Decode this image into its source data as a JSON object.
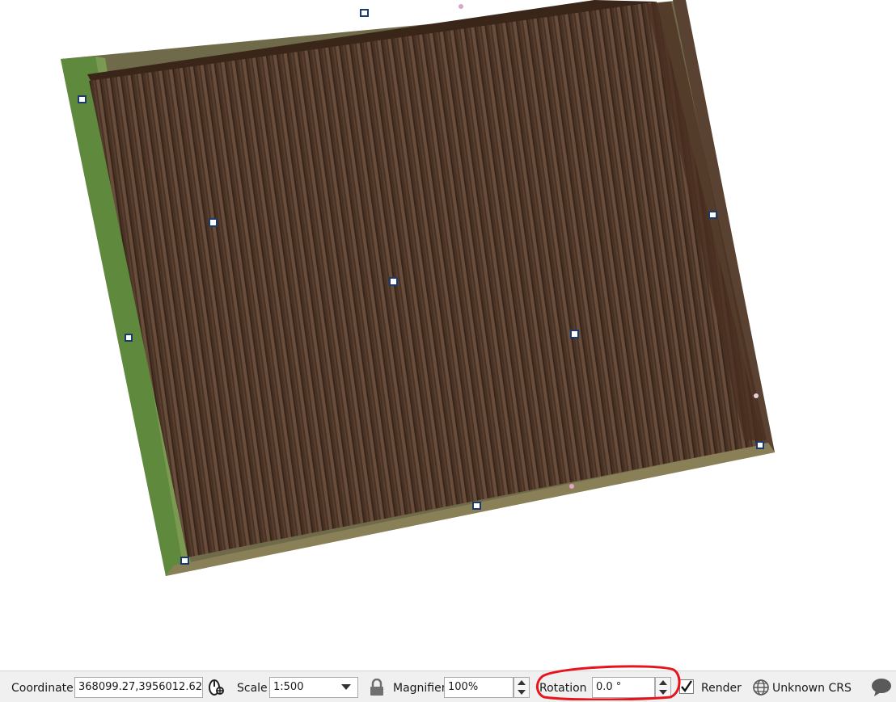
{
  "status_bar": {
    "coordinate_label": "Coordinate",
    "coordinate_value": "368099.27,3956012.62",
    "scale_label": "Scale",
    "scale_value": "1:500",
    "magnifier_label": "Magnifier",
    "magnifier_value": "100%",
    "rotation_label": "Rotation",
    "rotation_value": "0.0 °",
    "render_checked": true,
    "render_label": "Render",
    "crs_label": "Unknown CRS"
  },
  "annotation": {
    "highlight_color": "#e8141b",
    "highlight_target": "rotation-field"
  },
  "map": {
    "layer": "aerial orthophoto of plowed field with ground control targets",
    "field_color": "#4a3324",
    "border_grass_color": "#6b8a48"
  }
}
